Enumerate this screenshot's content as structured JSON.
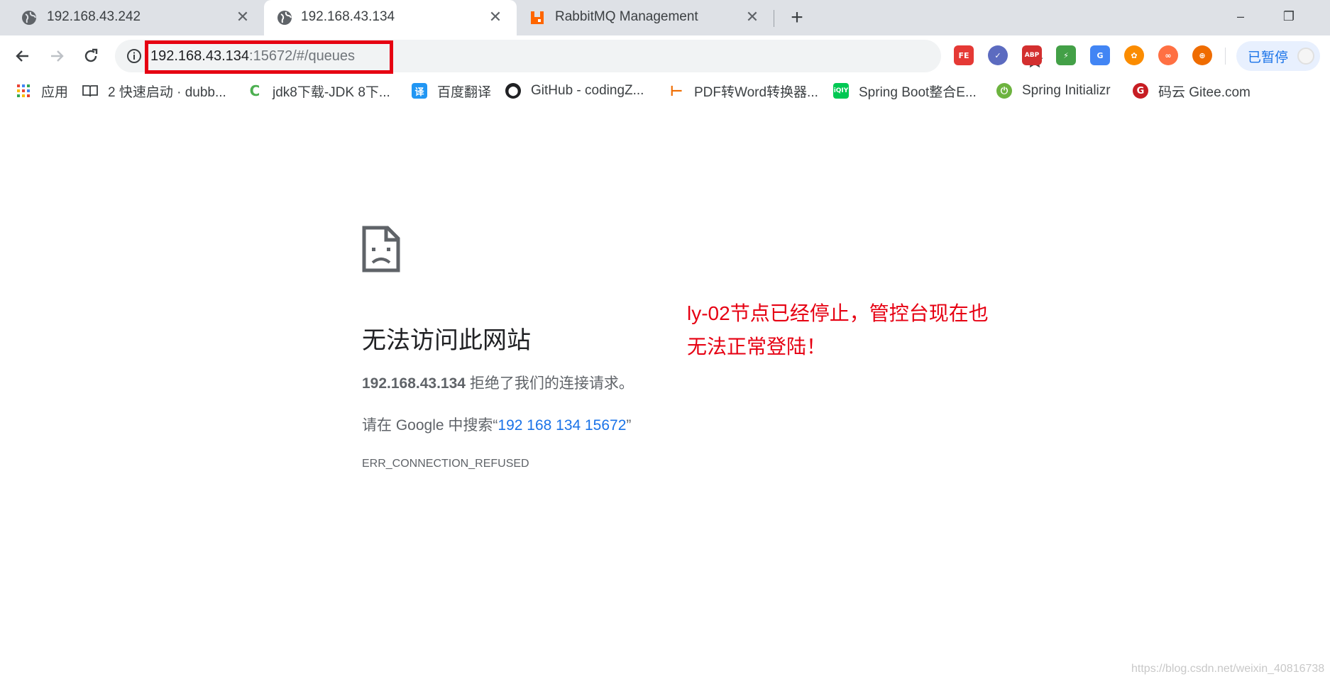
{
  "tabs": [
    {
      "title": "192.168.43.242",
      "icon": "globe-icon"
    },
    {
      "title": "192.168.43.134",
      "icon": "globe-icon",
      "active": true
    },
    {
      "title": "RabbitMQ Management",
      "icon": "rabbitmq-icon"
    }
  ],
  "tab_close_glyph": "✕",
  "new_tab_glyph": "+",
  "window_controls": {
    "minimize": "–",
    "restore": "❐"
  },
  "address": {
    "host": "192.168.43.134",
    "rest": ":15672/#/queues"
  },
  "extensions": [
    "FE",
    "✓",
    "ABP",
    "⚡",
    "G",
    "✿",
    "∞",
    "⊕"
  ],
  "profile": {
    "label": "已暂停"
  },
  "bookmarks": [
    {
      "label": "应用",
      "icon": "apps-grid-icon"
    },
    {
      "label": "2 快速启动 · dubb...",
      "icon": "book-icon"
    },
    {
      "label": "jdk8下载-JDK 8下...",
      "icon": "leaf-icon"
    },
    {
      "label": "百度翻译",
      "icon": "translate-icon"
    },
    {
      "label": "GitHub - codingZ...",
      "icon": "github-icon"
    },
    {
      "label": "PDF转Word转换器...",
      "icon": "pdf-icon"
    },
    {
      "label": "Spring Boot整合E...",
      "icon": "iqiyi-icon"
    },
    {
      "label": "Spring Initializr",
      "icon": "spring-icon"
    },
    {
      "label": "码云 Gitee.com",
      "icon": "gitee-icon"
    }
  ],
  "error": {
    "title": "无法访问此网站",
    "host": "192.168.43.134",
    "desc": " 拒绝了我们的连接请求。",
    "search_prefix": "请在 Google 中搜索“",
    "search_link": "192 168 134 15672",
    "search_suffix": "”",
    "code": "ERR_CONNECTION_REFUSED"
  },
  "annotation": {
    "line1": "ly-02节点已经停止，管控台现在也",
    "line2": "无法正常登陆！"
  },
  "watermark": "https://blog.csdn.net/weixin_40816738",
  "colors": {
    "annotation": "#e60012",
    "highlight_box": "#e60012",
    "link": "#1a73e8"
  }
}
